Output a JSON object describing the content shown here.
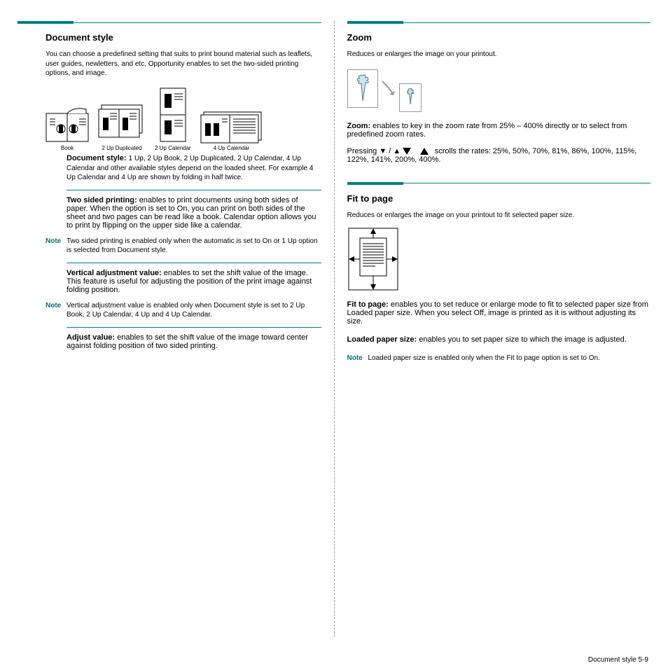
{
  "left": {
    "section_title": "Document style",
    "intro": "You can choose a predefined setting that suits to print bound material such as leaflets, user guides, newletters, and etc. Opportunity enables to set the two-sided printing options, and image.",
    "illus": [
      {
        "id": "book",
        "caption": "Book"
      },
      {
        "id": "2up_dup",
        "caption": "2 Up Duplicated"
      },
      {
        "id": "2up_cal",
        "caption": "2 Up Calendar"
      },
      {
        "id": "4up_cal",
        "caption": "4 Up Calendar"
      }
    ],
    "style_lead": "Document style:",
    "style_body": "1 Up, 2 Up Book, 2 Up Duplicated, 2 Up Calendar, 4 Up Calendar and other available styles depend on the loaded sheet. For example 4 Up Calendar and 4 Up are shown by folding in half twice.",
    "twosided_lead": "Two sided printing:",
    "twosided_body": "enables to print documents using both sides of paper. When the option is set to On, you can print on both sides of the sheet and two pages can be read like a book. Calendar option allows you to print by flipping on the upper side like a calendar.",
    "twosided_note": "Two sided printing is enabled only when the automatic is set to On or 1 Up option is selected from Document style.",
    "adjust_lead": "Vertical adjustment value:",
    "adjust_body": "enables to set the shift value of the image. This feature is useful for adjusting the position of the print image against folding position.",
    "adjust_note": "Vertical adjustment value is enabled only when Document style is set to 2 Up Book, 2 Up Calendar, 4 Up and 4 Up Calendar.",
    "adjust_item_lead": "Adjust value:",
    "adjust_item_body": "enables to set the shift value of the image toward center against folding position of two sided printing."
  },
  "right": {
    "zoom": {
      "title": "Zoom",
      "intro": "Reduces or enlarges the image on your printout.",
      "lead": "Zoom:",
      "body": "enables to key in the zoom rate from 25% – 400% directly or to select from predefined zoom rates.",
      "triangles_label": "Pressing ▼ / ▲",
      "triangles_body": "scrolls the rates: 25%, 50%, 70%, 81%, 86%, 100%, 115%, 122%, 141%, 200%, 400%."
    },
    "fit": {
      "title": "Fit to page",
      "intro": "Reduces or enlarges the image on your printout to fit selected paper size.",
      "lead": "Fit to page:",
      "body": "enables you to set reduce or enlarge mode to fit to selected paper size from Loaded paper size. When you select Off, image is printed as it is without adjusting its size.",
      "loaded_lead": "Loaded paper size:",
      "loaded_body": "enables you to set paper size to which the image is adjusted.",
      "loaded_note": "Loaded paper size is enabled only when the Fit to page option is set to On."
    }
  },
  "footer_page": "Document style   5-9"
}
